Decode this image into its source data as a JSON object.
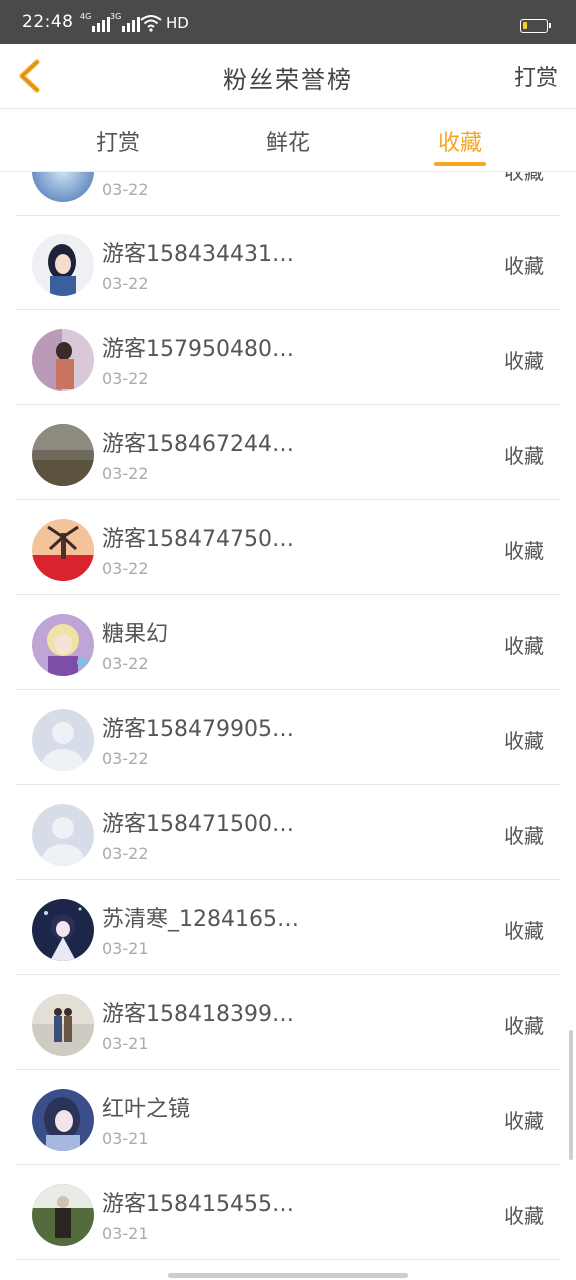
{
  "status_bar": {
    "time": "22:48",
    "signal_1": "4G",
    "signal_2": "3G",
    "hd": "HD"
  },
  "header": {
    "title": "粉丝荣誉榜",
    "right_action": "打赏"
  },
  "tabs": [
    {
      "label": "打赏"
    },
    {
      "label": "鲜花"
    },
    {
      "label": "收藏",
      "active": true
    }
  ],
  "colors": {
    "accent": "#f5a623",
    "text": "#555555",
    "subtext": "#aaaaaa"
  },
  "list": [
    {
      "name": "",
      "date": "03-22",
      "action": "收藏",
      "avatar": "blue-icon"
    },
    {
      "name": "游客158434431…",
      "date": "03-22",
      "action": "收藏",
      "avatar": "anime-girl"
    },
    {
      "name": "游客157950480…",
      "date": "03-22",
      "action": "收藏",
      "avatar": "photo-girl"
    },
    {
      "name": "游客158467244…",
      "date": "03-22",
      "action": "收藏",
      "avatar": "landscape"
    },
    {
      "name": "游客158474750…",
      "date": "03-22",
      "action": "收藏",
      "avatar": "windmill"
    },
    {
      "name": "糖果幻",
      "date": "03-22",
      "action": "收藏",
      "avatar": "anime-purple"
    },
    {
      "name": "游客158479905…",
      "date": "03-22",
      "action": "收藏",
      "avatar": "default-user"
    },
    {
      "name": "游客158471500…",
      "date": "03-22",
      "action": "收藏",
      "avatar": "default-user"
    },
    {
      "name": "苏清寒_1284165…",
      "date": "03-21",
      "action": "收藏",
      "avatar": "anime-dark"
    },
    {
      "name": "游客158418399…",
      "date": "03-21",
      "action": "收藏",
      "avatar": "couple-photo"
    },
    {
      "name": "红叶之镜",
      "date": "03-21",
      "action": "收藏",
      "avatar": "anime-blue"
    },
    {
      "name": "游客158415455…",
      "date": "03-21",
      "action": "收藏",
      "avatar": "person-photo"
    }
  ]
}
